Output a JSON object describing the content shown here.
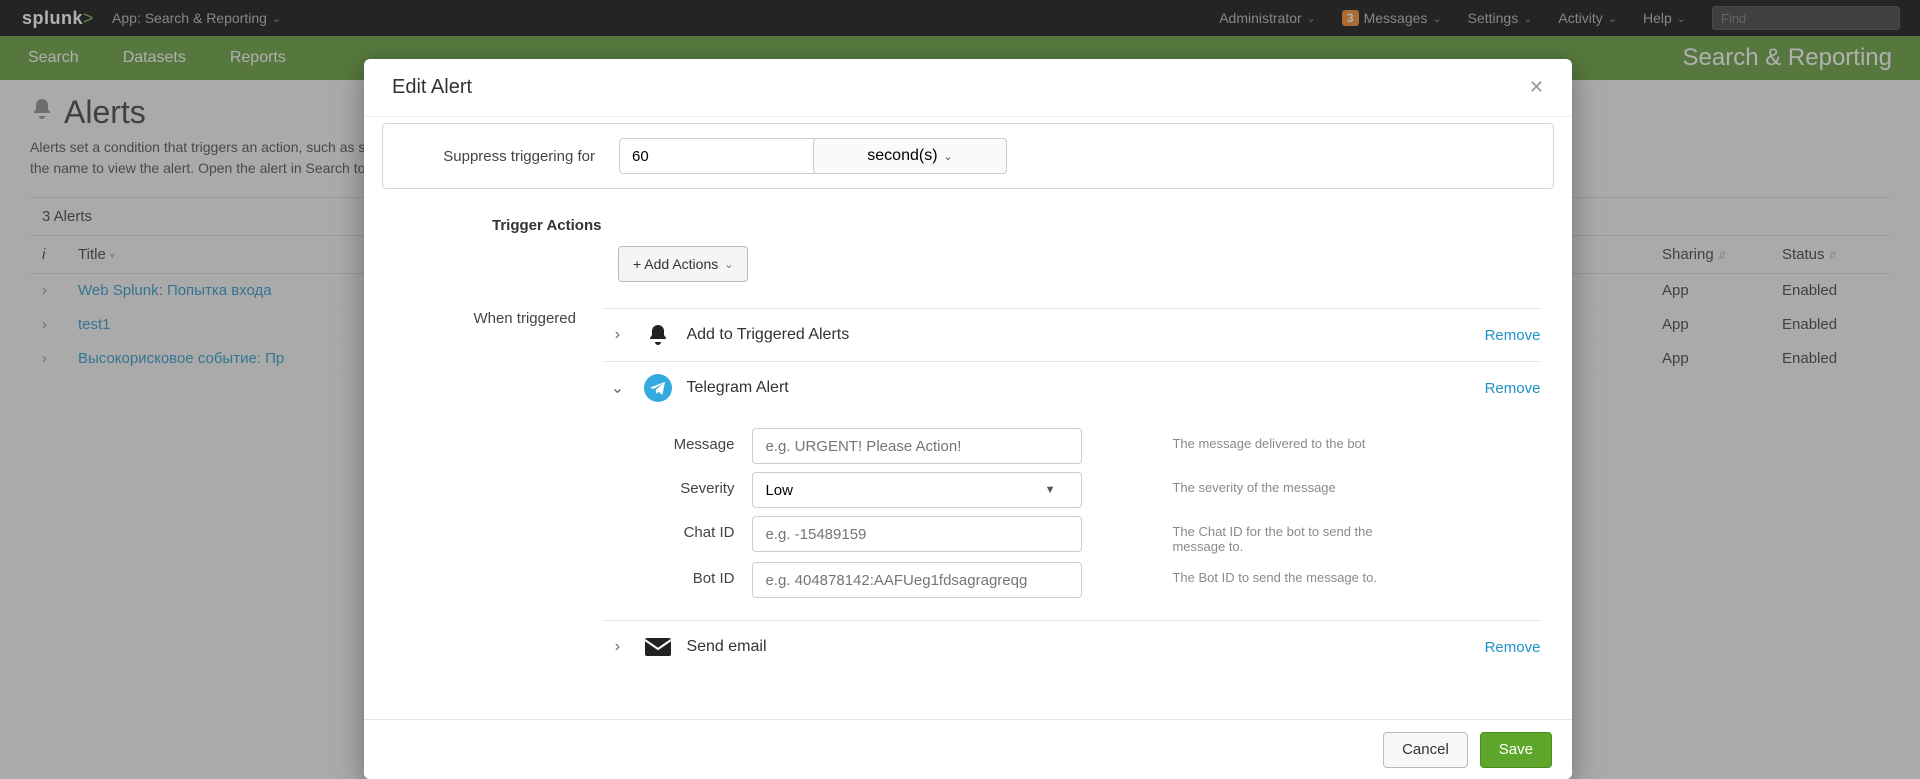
{
  "header": {
    "logo_text": "splunk",
    "logo_gt": ">",
    "app_label": "App: Search & Reporting",
    "admin": "Administrator",
    "messages_count": "3",
    "messages": "Messages",
    "settings": "Settings",
    "activity": "Activity",
    "help": "Help",
    "find_placeholder": "Find"
  },
  "nav": {
    "items": [
      "Search",
      "Datasets",
      "Reports"
    ],
    "app_title": "Search & Reporting"
  },
  "page": {
    "title": "Alerts",
    "subtitle": "Alerts set a condition that triggers an action, such as sending an email that contains the results of the triggering search to a list of people. Click the name to view the alert. Open the alert in Search to refine the parameters.",
    "count": "3 Alerts",
    "columns": {
      "i": "i",
      "title": "Title",
      "sharing": "Sharing",
      "status": "Status"
    },
    "rows": [
      {
        "title": "Web Splunk: Попытка входа",
        "sharing": "App",
        "status": "Enabled"
      },
      {
        "title": "test1",
        "sharing": "App",
        "status": "Enabled"
      },
      {
        "title": "Высокорисковое событие: Пр",
        "sharing": "App",
        "status": "Enabled"
      }
    ]
  },
  "modal": {
    "title": "Edit Alert",
    "suppress_label": "Suppress triggering for",
    "suppress_value": "60",
    "suppress_unit": "second(s)",
    "trigger_actions_title": "Trigger Actions",
    "add_actions_label": "+ Add Actions",
    "when_triggered": "When triggered",
    "remove": "Remove",
    "actions": {
      "triggered": {
        "name": "Add to Triggered Alerts"
      },
      "telegram": {
        "name": "Telegram Alert",
        "fields": {
          "message": {
            "label": "Message",
            "placeholder": "e.g. URGENT! Please Action!",
            "help": "The message delivered to the bot"
          },
          "severity": {
            "label": "Severity",
            "value": "Low",
            "help": "The severity of the message"
          },
          "chat_id": {
            "label": "Chat ID",
            "placeholder": "e.g. -15489159",
            "help": "The Chat ID for the bot to send the message to."
          },
          "bot_id": {
            "label": "Bot ID",
            "placeholder": "e.g. 404878142:AAFUeg1fdsagragreqg",
            "help": "The Bot ID to send the message to."
          }
        }
      },
      "email": {
        "name": "Send email"
      }
    },
    "cancel": "Cancel",
    "save": "Save"
  }
}
